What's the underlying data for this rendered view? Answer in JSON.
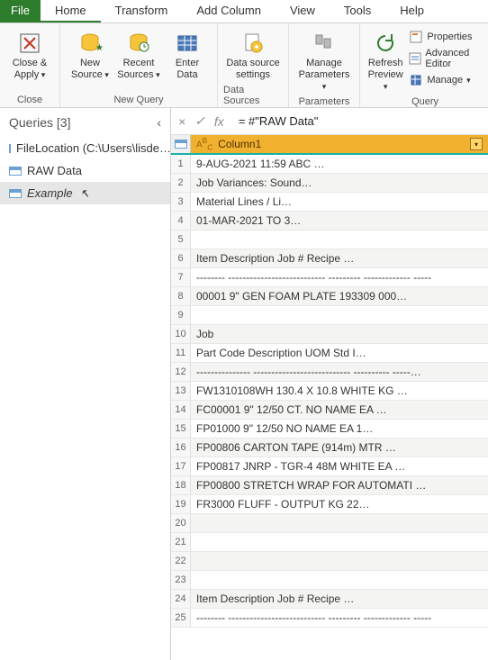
{
  "menu": {
    "file": "File",
    "tabs": [
      "Home",
      "Transform",
      "Add Column",
      "View",
      "Tools",
      "Help"
    ],
    "active": 0
  },
  "ribbon": {
    "groups": {
      "close": {
        "label": "Close",
        "close_apply": "Close &\nApply"
      },
      "newquery": {
        "label": "New Query",
        "new_source": "New\nSource",
        "recent_sources": "Recent\nSources",
        "enter_data": "Enter\nData"
      },
      "datasources": {
        "label": "Data Sources",
        "settings": "Data source\nsettings"
      },
      "parameters": {
        "label": "Parameters",
        "manage": "Manage\nParameters"
      },
      "query": {
        "label": "Query",
        "refresh": "Refresh\nPreview",
        "properties": "Properties",
        "adv_editor": "Advanced Editor",
        "manage": "Manage"
      }
    }
  },
  "queries": {
    "title": "Queries",
    "count": "[3]",
    "items": [
      {
        "label": "FileLocation (C:\\Users\\lisde…"
      },
      {
        "label": "RAW Data"
      },
      {
        "label": "Example"
      }
    ],
    "active": 2
  },
  "formula_bar": {
    "cancel": "×",
    "confirm": "✓",
    "fx": "fx",
    "text": "= #\"RAW Data\""
  },
  "grid": {
    "column": {
      "type_label": "ABC",
      "name": "Column1"
    },
    "rows": [
      {
        "n": 1,
        "v": "9-AUG-2021 11:59                                   ABC …"
      },
      {
        "n": 2,
        "v": "                                           Job Variances: Sound…"
      },
      {
        "n": 3,
        "v": "                                             Material Lines / Li…"
      },
      {
        "n": 4,
        "v": "                                            01-MAR-2021 TO 3…"
      },
      {
        "n": 5,
        "v": ""
      },
      {
        "n": 6,
        "v": "Item       Description                 Job #  Recipe        …"
      },
      {
        "n": 7,
        "v": "--------  ---------------------------    --------- ------------- -----"
      },
      {
        "n": 8,
        "v": "00001      9\" GEN FOAM PLATE        193309 000…"
      },
      {
        "n": 9,
        "v": ""
      },
      {
        "n": 10,
        "v": "                                                Job"
      },
      {
        "n": 11,
        "v": "        Part Code   Description              UOM    Std I…"
      },
      {
        "n": 12,
        "v": "        ---------------  ---------------------------    ----------  -----…"
      },
      {
        "n": 13,
        "v": "        FW1310108WH  130.4 X 10.8          WHITE KG …"
      },
      {
        "n": 14,
        "v": "        FC00001      9\" 12/50 CT. NO NAME    EA     …"
      },
      {
        "n": 15,
        "v": "        FP01000      9\" 12/50 NO NAME         EA      1…"
      },
      {
        "n": 16,
        "v": "        FP00806      CARTON TAPE (914m)      MTR   …"
      },
      {
        "n": 17,
        "v": "        FP00817      JNRP - TGR-4 48M WHITE   EA    …"
      },
      {
        "n": 18,
        "v": "        FP00800      STRETCH WRAP FOR AUTOMATI …"
      },
      {
        "n": 19,
        "v": "        FR3000        FLUFF - OUTPUT             KG       22…"
      },
      {
        "n": 20,
        "v": ""
      },
      {
        "n": 21,
        "v": ""
      },
      {
        "n": 22,
        "v": ""
      },
      {
        "n": 23,
        "v": ""
      },
      {
        "n": 24,
        "v": "Item       Description                 Job #  Recipe         …"
      },
      {
        "n": 25,
        "v": "--------  ---------------------------    --------- -------------  -----"
      }
    ]
  }
}
